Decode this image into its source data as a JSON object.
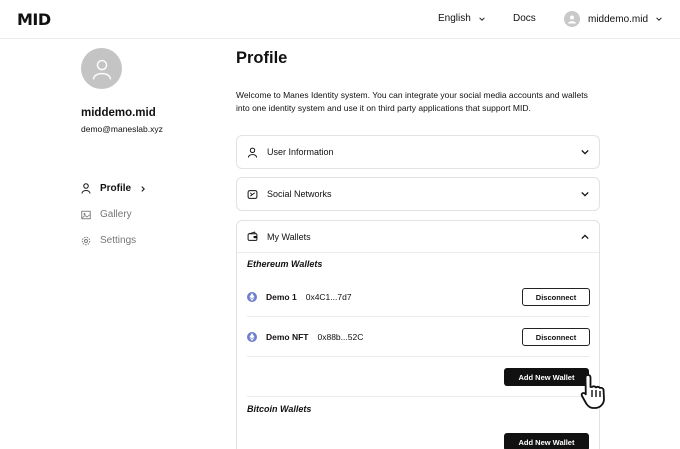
{
  "header": {
    "logo": "MID",
    "language": "English",
    "docs": "Docs",
    "username": "middemo.mid"
  },
  "sidebar": {
    "name": "middemo.mid",
    "email": "demo@maneslab.xyz",
    "nav": [
      {
        "label": "Profile",
        "icon": "user-icon",
        "active": true
      },
      {
        "label": "Gallery",
        "icon": "image-icon",
        "active": false
      },
      {
        "label": "Settings",
        "icon": "gear-icon",
        "active": false
      }
    ]
  },
  "main": {
    "title": "Profile",
    "intro": "Welcome to Manes Identity system. You can integrate your social media accounts and wallets into one identity system and use it on third party applications that support MID.",
    "sections": {
      "user_info": "User Information",
      "social": "Social Networks",
      "wallets": "My Wallets"
    },
    "ethereum": {
      "title": "Ethereum Wallets",
      "wallets": [
        {
          "name": "Demo 1",
          "address": "0x4C1...7d7",
          "action": "Disconnect"
        },
        {
          "name": "Demo NFT",
          "address": "0x88b...52C",
          "action": "Disconnect"
        }
      ],
      "add_label": "Add New Wallet"
    },
    "bitcoin": {
      "title": "Bitcoin Wallets",
      "add_label": "Add New Wallet"
    }
  },
  "colors": {
    "accent": "#111111",
    "eth_icon": "#6e7fd0",
    "muted_text": "#777777",
    "border": "#e2e2e2"
  }
}
